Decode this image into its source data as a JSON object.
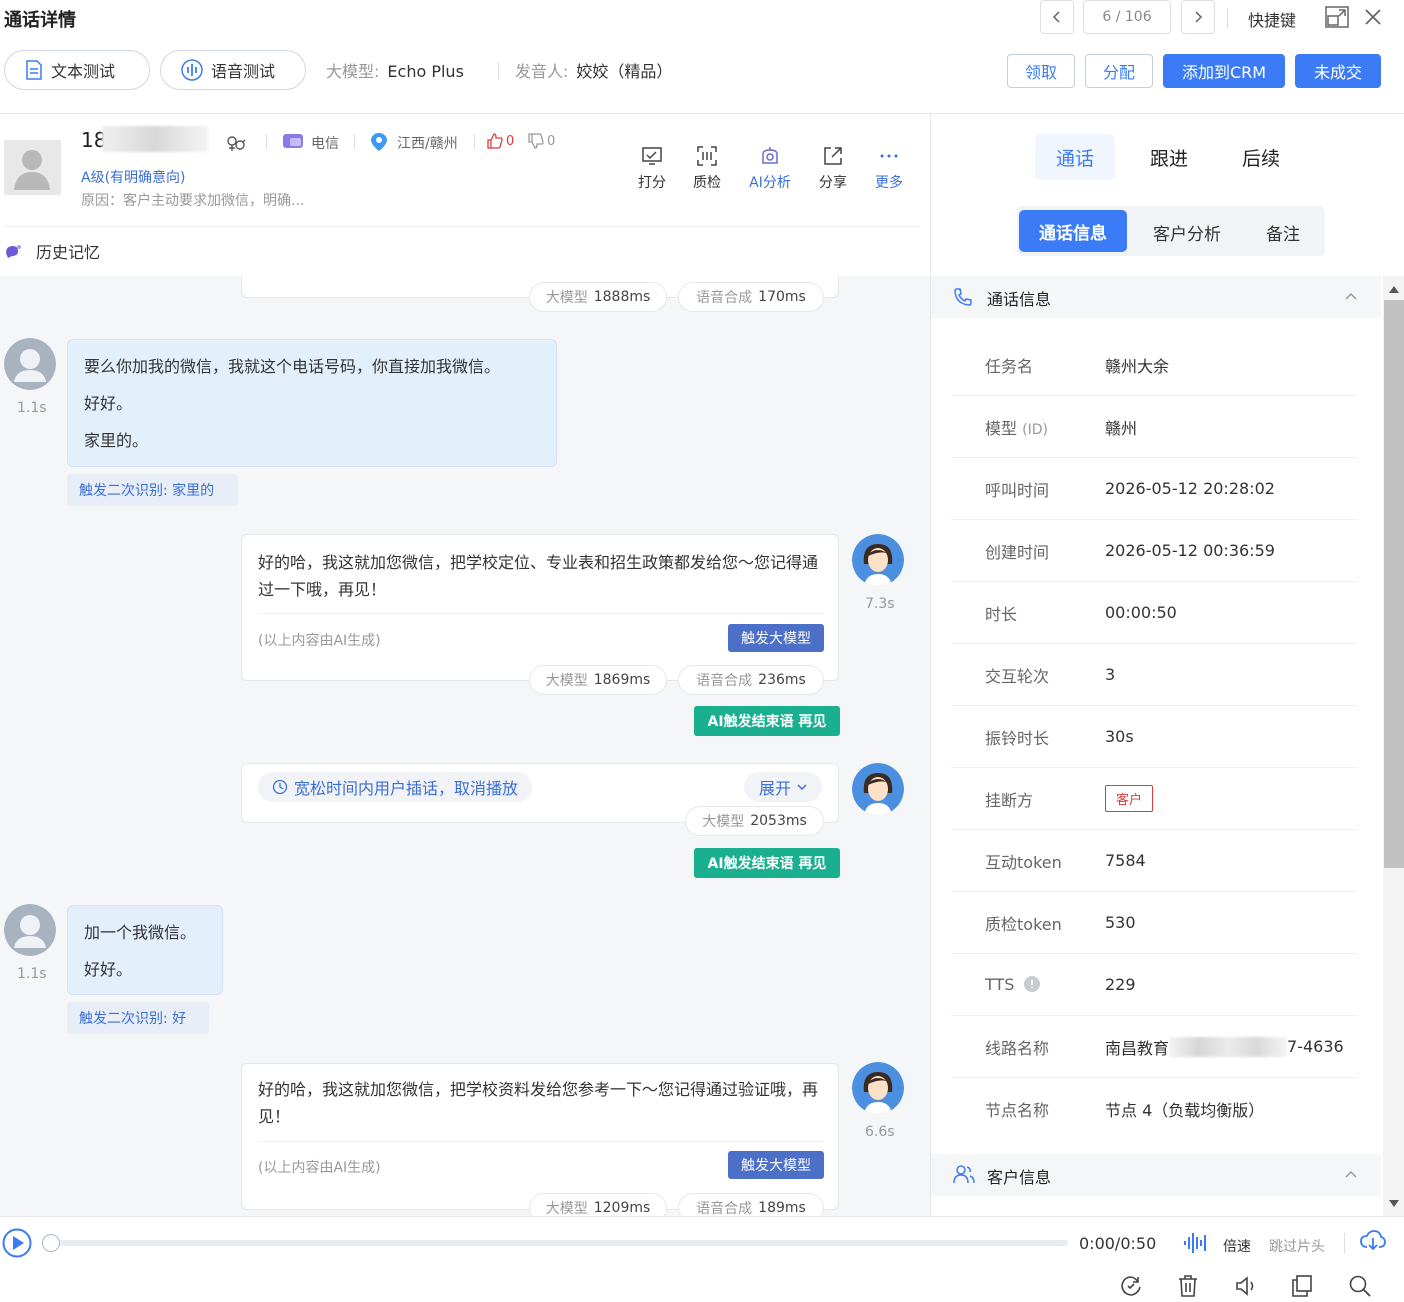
{
  "header": {
    "title": "通话详情",
    "pager": "6 / 106",
    "shortcut_label": "快捷键",
    "text_test": "文本测试",
    "voice_test": "语音测试",
    "model_label": "大模型:",
    "model_value": "Echo Plus",
    "speaker_label": "发音人:",
    "speaker_value": "姣姣（精品）",
    "btn_claim": "领取",
    "btn_assign": "分配",
    "btn_crm": "添加到CRM",
    "btn_deal": "未成交"
  },
  "customer": {
    "phone_prefix": "18",
    "carrier": "电信",
    "location": "江西/赣州",
    "likes": "0",
    "dislikes": "0",
    "grade": "A级(有明确意向)",
    "reason": "原因：客户主动要求加微信，明确...",
    "history": "历史记忆"
  },
  "tools": [
    {
      "label": "打分"
    },
    {
      "label": "质检"
    },
    {
      "label": "AI分析"
    },
    {
      "label": "分享"
    },
    {
      "label": "更多"
    }
  ],
  "chat": {
    "llm_label": "大模型",
    "tts_label": "语音合成",
    "ai_note": "(以上内容由AI生成)",
    "trigger_llm": "触发大模型",
    "ai_end": "AI触发结束语 再见",
    "top_llm": "1888ms",
    "top_tts": "170ms",
    "u1_lines": [
      "要么你加我的微信，我就这个电话号码，你直接加我微信。",
      "好好。",
      "家里的。"
    ],
    "u1_time": "1.1s",
    "u1_tag": "触发二次识别: 家里的",
    "a1_text": "好的哈，我这就加您微信，把学校定位、专业表和招生政策都发给您～您记得通过一下哦，再见！",
    "a1_time": "7.3s",
    "a1_llm": "1869ms",
    "a1_tts": "236ms",
    "interrupt_text": "宽松时间内用户插话，取消播放",
    "expand": "展开",
    "int_llm": "2053ms",
    "u2_lines": [
      "加一个我微信。",
      "好好。"
    ],
    "u2_time": "1.1s",
    "u2_tag": "触发二次识别: 好",
    "a2_text": "好的哈，我这就加您微信，把学校资料发给您参考一下～您记得通过验证哦，再见！",
    "a2_time": "6.6s",
    "a2_llm": "1209ms",
    "a2_tts": "189ms"
  },
  "right": {
    "tabs": [
      "通话",
      "跟进",
      "后续"
    ],
    "subtabs": [
      "通话信息",
      "客户分析",
      "备注"
    ],
    "section_call": "通话信息",
    "section_customer": "客户信息",
    "rows": [
      {
        "k": "任务名",
        "v": "赣州大余"
      },
      {
        "k": "模型",
        "k2": "(ID)",
        "v": "赣州"
      },
      {
        "k": "呼叫时间",
        "v": "2026-05-12 20:28:02"
      },
      {
        "k": "创建时间",
        "v": "2026-05-12 00:36:59"
      },
      {
        "k": "时长",
        "v": "00:00:50"
      },
      {
        "k": "交互轮次",
        "v": "3"
      },
      {
        "k": "振铃时长",
        "v": "30s"
      },
      {
        "k": "挂断方",
        "v": "客户"
      },
      {
        "k": "互动token",
        "v": "7584"
      },
      {
        "k": "质检token",
        "v": "530"
      },
      {
        "k": "TTS",
        "v": "229"
      },
      {
        "k": "线路名称",
        "v": "南昌教育",
        "v2": "7-4636"
      },
      {
        "k": "节点名称",
        "v": "节点 4（负载均衡版）"
      }
    ]
  },
  "player": {
    "time": "0:00/0:50",
    "speed": "倍速",
    "skip": "跳过片头"
  },
  "colors": {
    "accent": "#3b7cf6",
    "green": "#1aaf8f",
    "red": "#e03a3a"
  }
}
